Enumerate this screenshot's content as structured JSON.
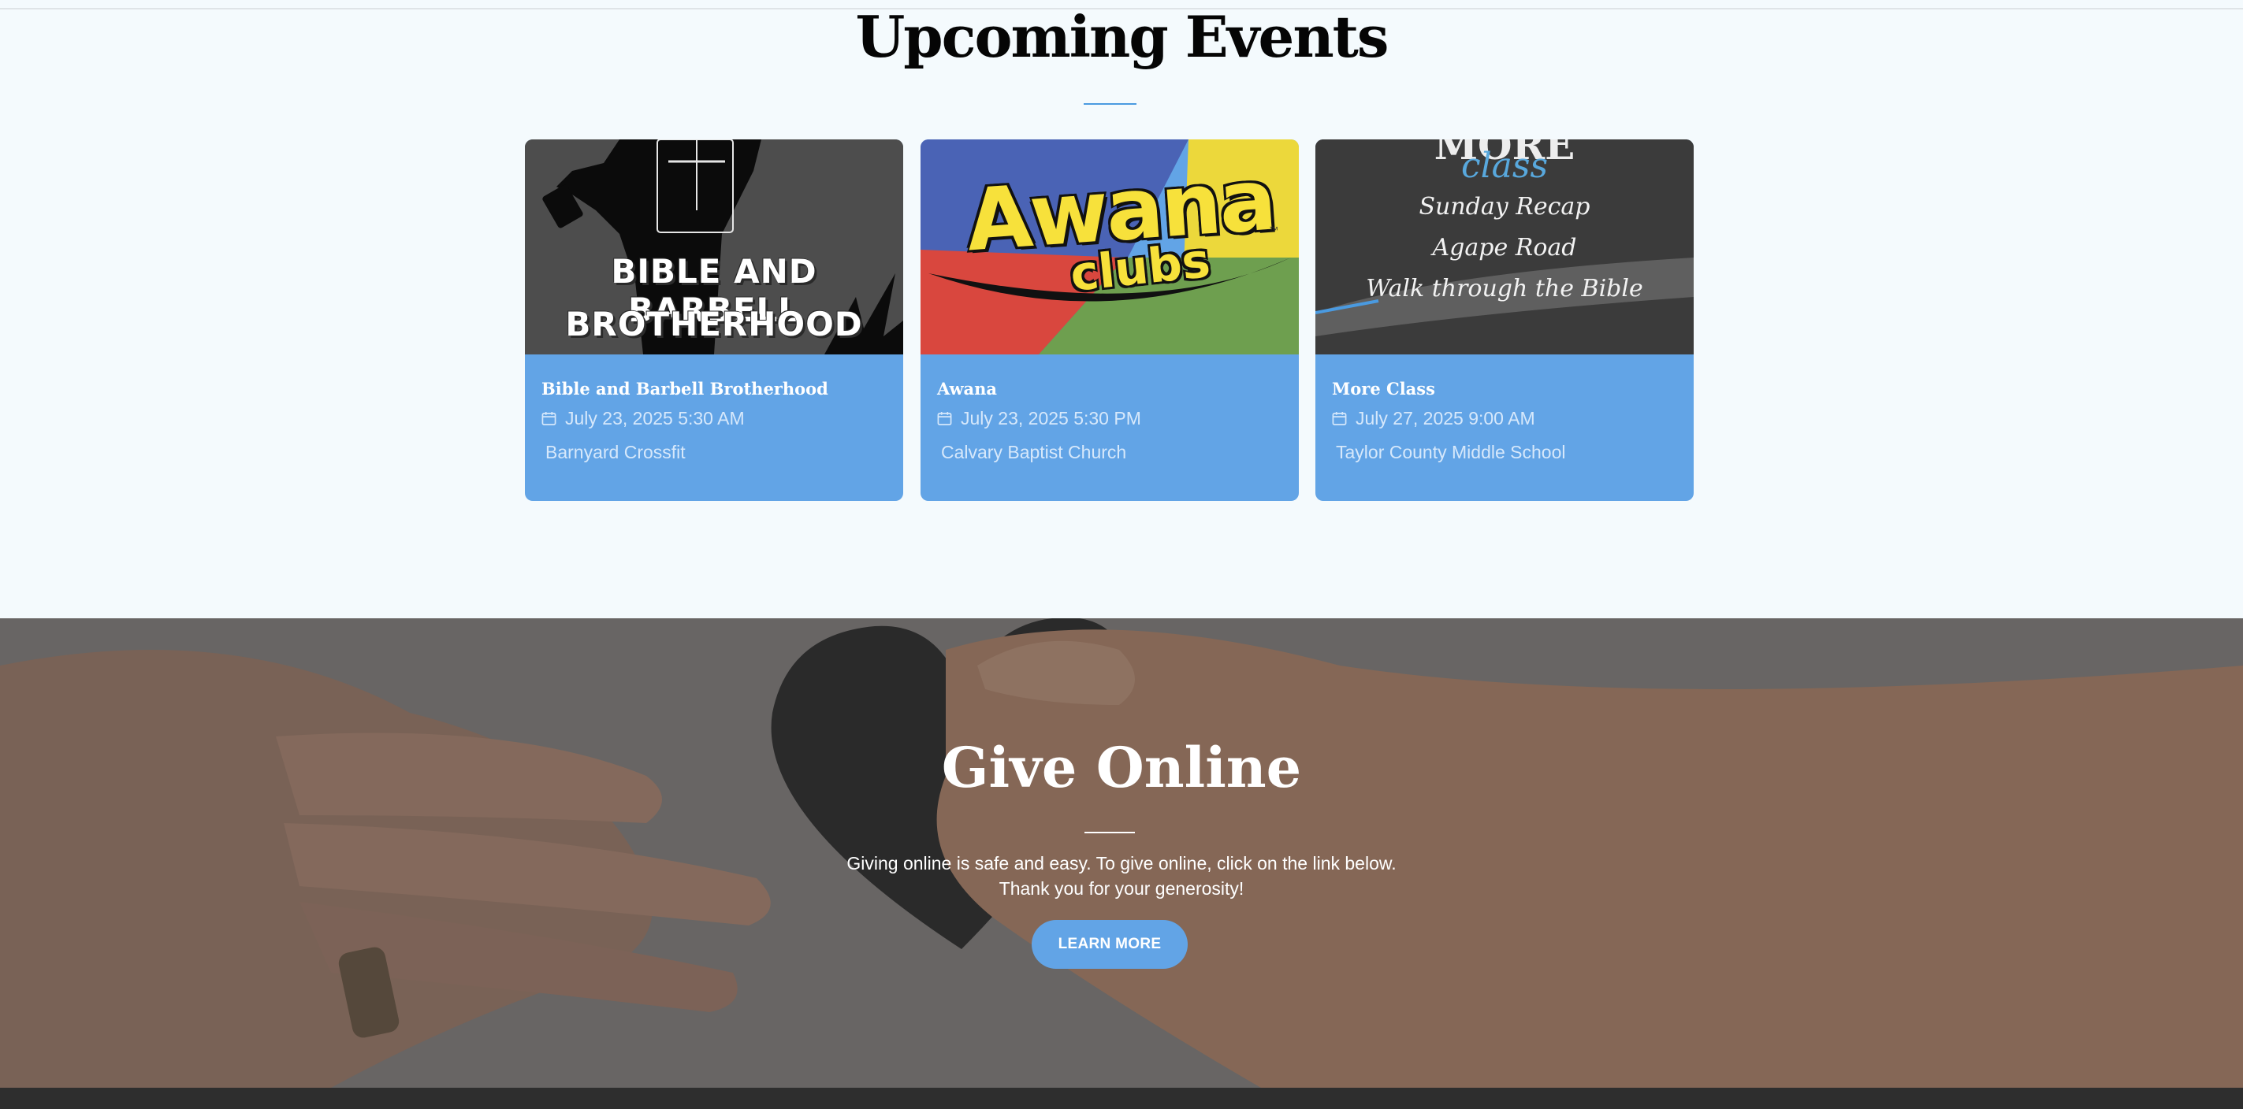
{
  "events": {
    "title": "Upcoming Events",
    "cards": [
      {
        "image_text": [
          "BIBLE AND BARBELL",
          "BROTHERHOOD"
        ],
        "title": "Bible and Barbell Brotherhood",
        "date": "July 23, 2025 5:30 AM",
        "location": "Barnyard Crossfit"
      },
      {
        "image_text": [
          "Awana",
          "clubs",
          "™"
        ],
        "title": "Awana",
        "date": "July 23, 2025 5:30 PM",
        "location": "Calvary Baptist Church"
      },
      {
        "image_text": [
          "MORE",
          "class",
          "Sunday Recap",
          "Agape Road",
          "Walk through the Bible"
        ],
        "title": "More Class",
        "date": "July 27, 2025 9:00 AM",
        "location": "Taylor County Middle School"
      }
    ]
  },
  "give": {
    "title": "Give Online",
    "line1": "Giving online is safe and easy. To give online, click on the link below.",
    "line2": "Thank you for your generosity!",
    "button": "LEARN MORE"
  },
  "colors": {
    "accent": "#62a4e6",
    "page_background": "#f4fafd",
    "footer": "#2e2e2e"
  },
  "icons": {
    "event_date": "calendar-icon"
  }
}
